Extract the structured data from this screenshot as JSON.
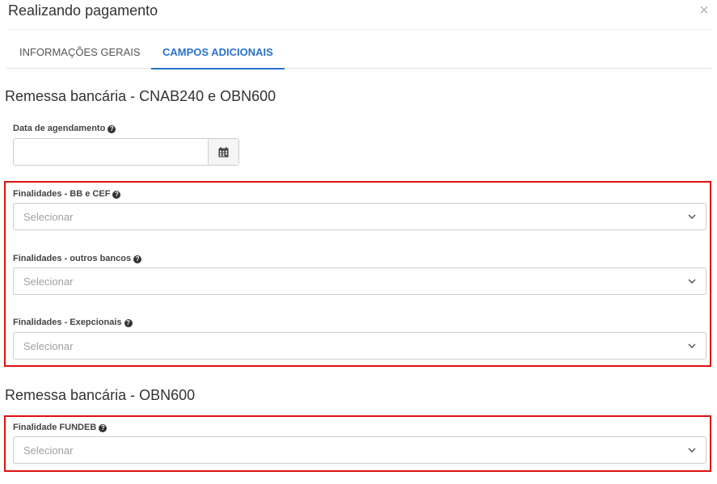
{
  "modal": {
    "title": "Realizando pagamento",
    "close_label": "×"
  },
  "tabs": [
    {
      "label": "INFORMAÇÕES GERAIS",
      "active": false
    },
    {
      "label": "CAMPOS ADICIONAIS",
      "active": true
    }
  ],
  "sections": {
    "cnab": {
      "heading": "Remessa bancária - CNAB240 e OBN600",
      "date_label": "Data de agendamento",
      "date_value": "",
      "fields": [
        {
          "label": "Finalidades - BB e CEF",
          "placeholder": "Selecionar"
        },
        {
          "label": "Finalidades - outros bancos",
          "placeholder": "Selecionar"
        },
        {
          "label": "Finalidades - Exepcionais",
          "placeholder": "Selecionar"
        }
      ]
    },
    "obn": {
      "heading": "Remessa bancária - OBN600",
      "fields": [
        {
          "label": "Finalidade FUNDEB",
          "placeholder": "Selecionar"
        }
      ]
    }
  },
  "icons": {
    "help": "question-circle-icon",
    "calendar": "calendar-icon",
    "chevron": "chevron-down-icon",
    "close": "close-icon"
  },
  "colors": {
    "accent": "#2a72c9",
    "highlight": "#e01010",
    "placeholder": "#a0a0a0"
  }
}
